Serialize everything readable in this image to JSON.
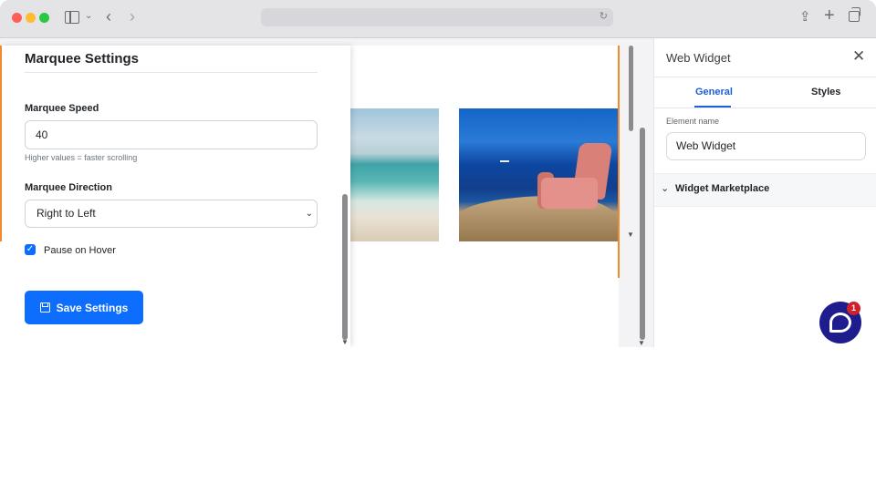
{
  "browser": {
    "icons": [
      "close-light",
      "minimize-light",
      "zoom-light",
      "sidebar-icon",
      "chevron-down-icon",
      "back-icon",
      "forward-icon",
      "reload-icon",
      "share-icon",
      "plus-icon",
      "tabs-icon"
    ],
    "symbols": {
      "chevron": "⌄",
      "back": "‹",
      "forward": "›",
      "reload": "↻",
      "share": "⇪",
      "new_tab": "+"
    }
  },
  "settings": {
    "title": "Marquee Settings",
    "speed_label": "Marquee Speed",
    "speed_value": "40",
    "speed_help": "Higher values = faster scrolling",
    "direction_label": "Marquee Direction",
    "direction_value": "Right to Left",
    "direction_caret": "⌄",
    "pause_label": "Pause on Hover",
    "pause_checked": true,
    "pause_check_glyph": "✓",
    "save_label": "Save Settings"
  },
  "scrollbar": {
    "down_arrow": "▼"
  },
  "inspector": {
    "title": "Web Widget",
    "close_glyph": "✕",
    "tabs": [
      {
        "label": "General",
        "active": true
      },
      {
        "label": "Styles",
        "active": false
      }
    ],
    "element_name_label": "Element name",
    "element_name_value": "Web Widget",
    "section_chevron": "⌄",
    "section_label": "Widget Marketplace"
  },
  "chat": {
    "badge_count": "1"
  },
  "colors": {
    "accent": "#0d6efd",
    "tab_active": "#1d5fd6",
    "frame_edge": "#f08a2e",
    "chat": "#1f1d8e",
    "badge": "#d0212a"
  }
}
